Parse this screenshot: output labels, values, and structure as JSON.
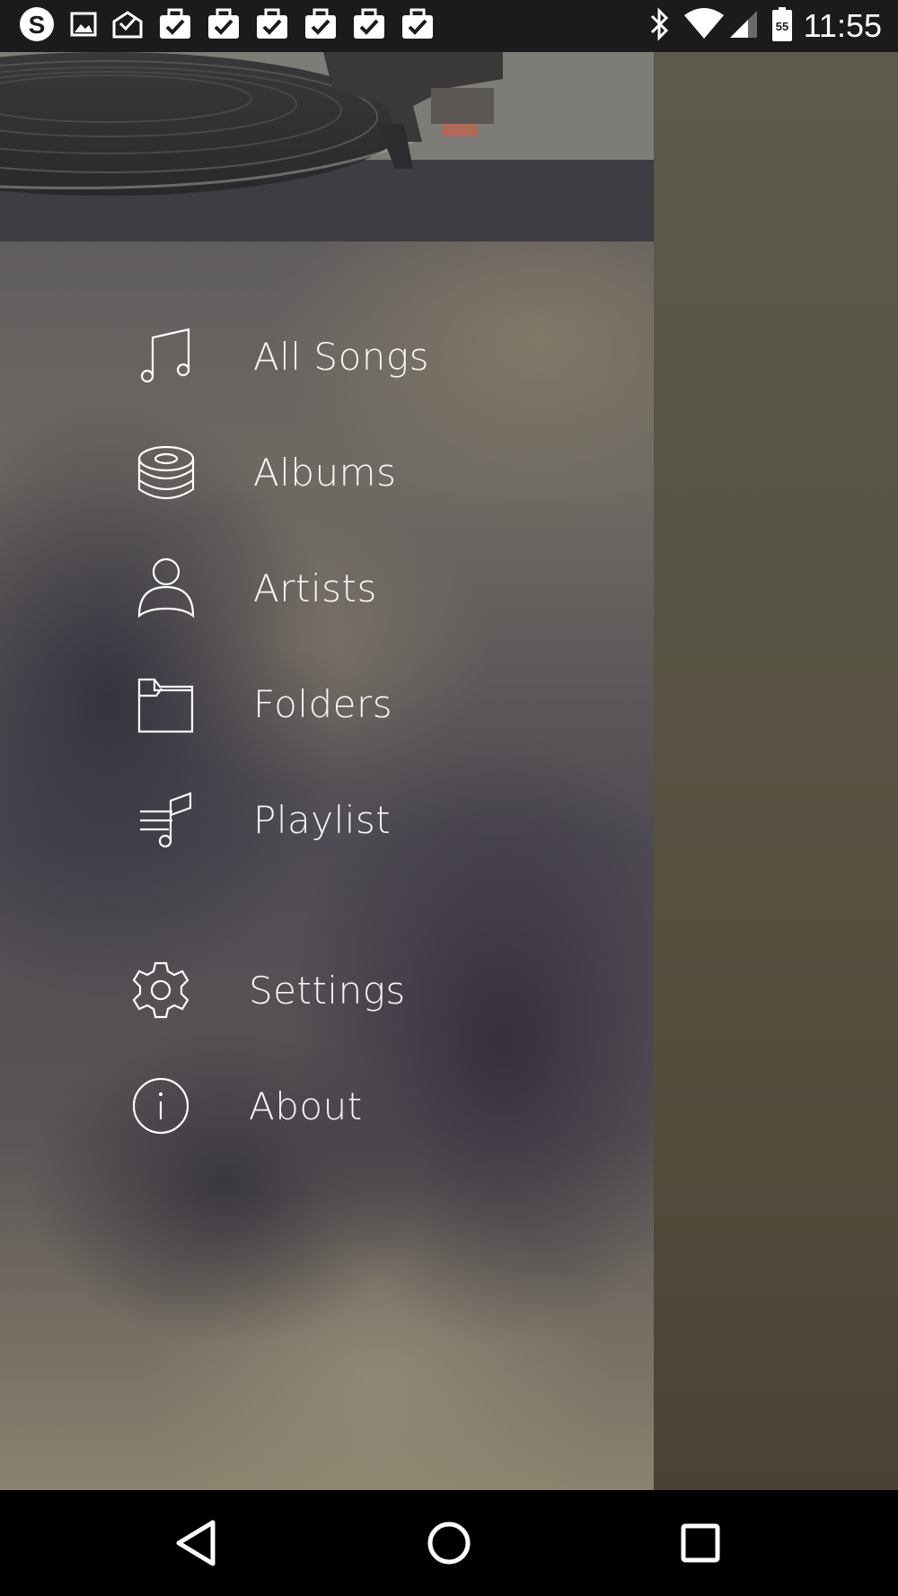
{
  "status_bar": {
    "time": "11:55",
    "battery_level": "55",
    "left_icons": [
      "skype-icon",
      "image-icon",
      "mail-check-icon",
      "task-check-icon",
      "task-check-icon",
      "task-check-icon",
      "task-check-icon",
      "task-check-icon",
      "task-check-icon"
    ],
    "right_icons": [
      "bluetooth-icon",
      "wifi-icon",
      "cell-signal-icon",
      "battery-icon"
    ]
  },
  "drawer": {
    "header_image": "turntable-photo",
    "primary_items": [
      {
        "label": "All Songs",
        "icon": "music-note-icon"
      },
      {
        "label": "Albums",
        "icon": "album-stack-icon"
      },
      {
        "label": "Artists",
        "icon": "person-icon"
      },
      {
        "label": "Folders",
        "icon": "folder-icon"
      },
      {
        "label": "Playlist",
        "icon": "playlist-icon"
      }
    ],
    "secondary_items": [
      {
        "label": "Settings",
        "icon": "gear-icon"
      },
      {
        "label": "About",
        "icon": "info-icon"
      }
    ]
  },
  "nav_bar": {
    "buttons": [
      "back-icon",
      "home-icon",
      "recents-icon"
    ]
  },
  "colors": {
    "status_bar_bg": "#1c1a1b",
    "text": "#ffffff",
    "nav_bar_bg": "#000000"
  }
}
